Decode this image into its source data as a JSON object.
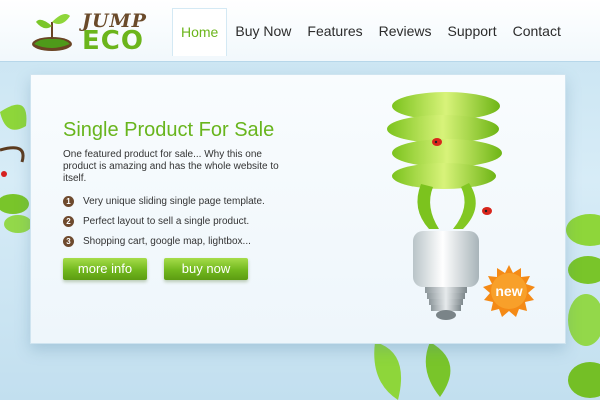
{
  "brand": {
    "logo_top": "JUMP",
    "logo_bottom": "ECO"
  },
  "nav": {
    "items": [
      {
        "label": "Home",
        "active": true
      },
      {
        "label": "Buy Now",
        "active": false
      },
      {
        "label": "Features",
        "active": false
      },
      {
        "label": "Reviews",
        "active": false
      },
      {
        "label": "Support",
        "active": false
      },
      {
        "label": "Contact",
        "active": false
      }
    ]
  },
  "hero": {
    "title": "Single Product For Sale",
    "description": "One featured product for sale... Why this one product is amazing and has the whole website to itself.",
    "features": [
      {
        "num": "1",
        "text": "Very unique sliding single page template."
      },
      {
        "num": "2",
        "text": "Perfect layout to sell a single product."
      },
      {
        "num": "3",
        "text": "Shopping cart, google map, lightbox..."
      }
    ],
    "more_info_label": "more info",
    "buy_now_label": "buy now",
    "badge_label": "new"
  },
  "colors": {
    "accent_green": "#6cb51c",
    "badge_orange": "#f48a16",
    "feature_number_brown": "#6e4a2e"
  },
  "icons": {
    "logo": "sprout-on-soil-icon",
    "product": "cfl-light-bulb-with-ladybugs",
    "badge": "starburst-badge"
  }
}
